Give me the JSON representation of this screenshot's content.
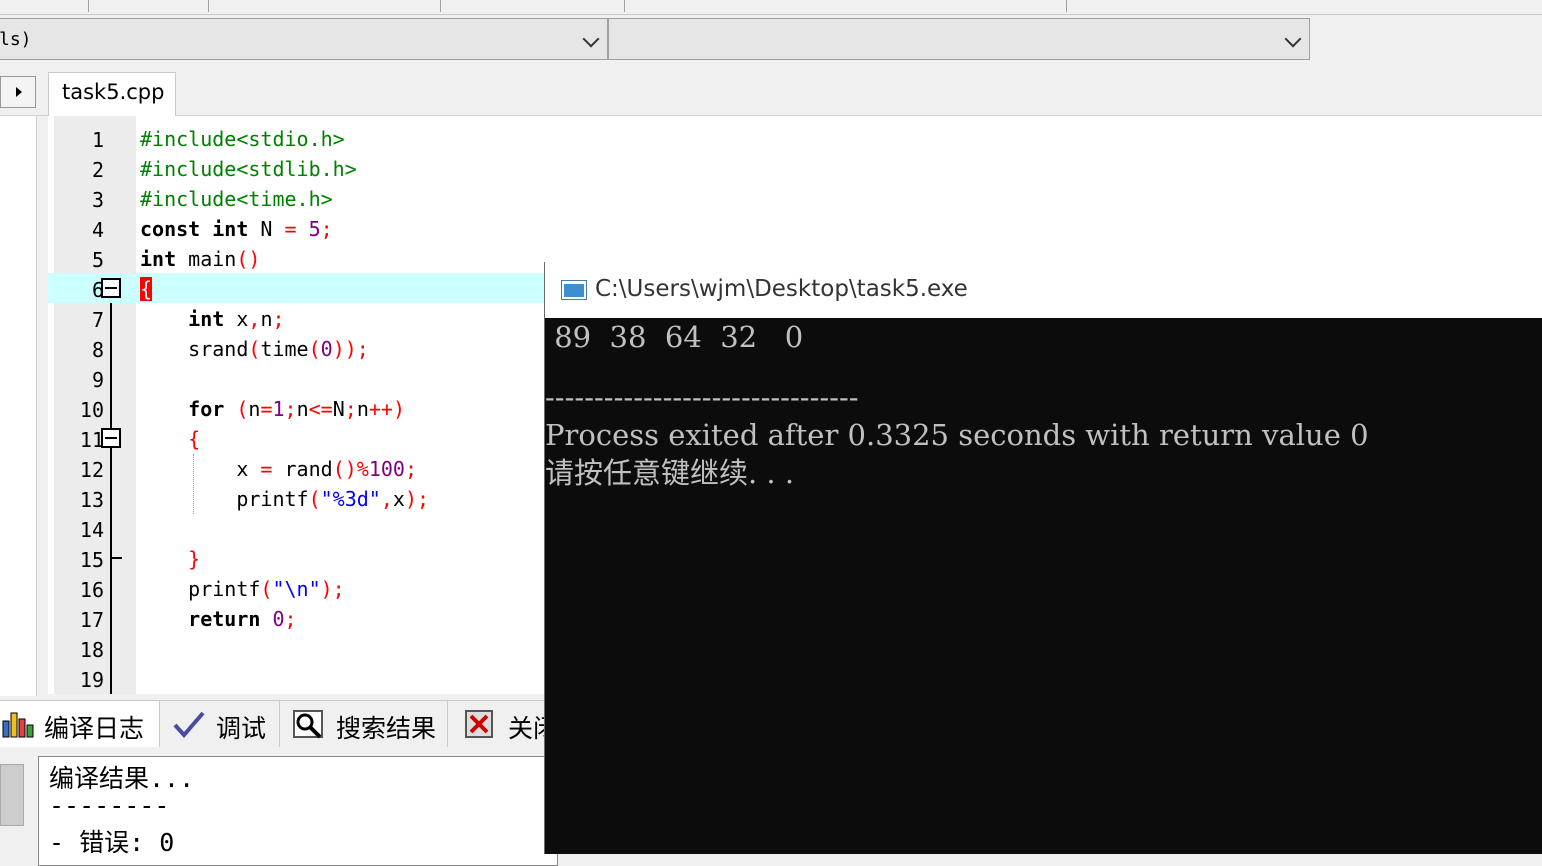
{
  "toolbar": {
    "class_combo_value": "ls)",
    "member_combo_value": ""
  },
  "tabs": [
    {
      "label": "task5.cpp",
      "active": true
    }
  ],
  "editor": {
    "active_line": 6,
    "line_numbers": [
      "1",
      "2",
      "3",
      "4",
      "5",
      "6",
      "7",
      "8",
      "9",
      "10",
      "11",
      "12",
      "13",
      "14",
      "15",
      "16",
      "17",
      "18",
      "19"
    ]
  },
  "bottom_tabs": [
    {
      "label": "编译日志",
      "icon": "chart-icon"
    },
    {
      "label": "调试",
      "icon": "check-icon"
    },
    {
      "label": "搜索结果",
      "icon": "search-icon"
    },
    {
      "label": "关闭",
      "icon": "close-icon"
    }
  ],
  "compile_log": {
    "line1": "编译结果...",
    "line2": "--------",
    "line3": "- 错误: 0"
  },
  "console": {
    "title": "C:\\Users\\wjm\\Desktop\\task5.exe",
    "output_line": " 89  38  64  32   0",
    "separator": "--------------------------------",
    "exit_message": "Process exited after 0.3325 seconds with return value 0",
    "press_key": "请按任意键继续. . ."
  },
  "colors": {
    "active_line_bg": "#ccffff",
    "preprocessor": "#008000",
    "symbol": "#ff0000",
    "number": "#800080",
    "string": "#0000ff",
    "console_bg": "#0c0c0c",
    "console_text": "#c0c0c0"
  }
}
